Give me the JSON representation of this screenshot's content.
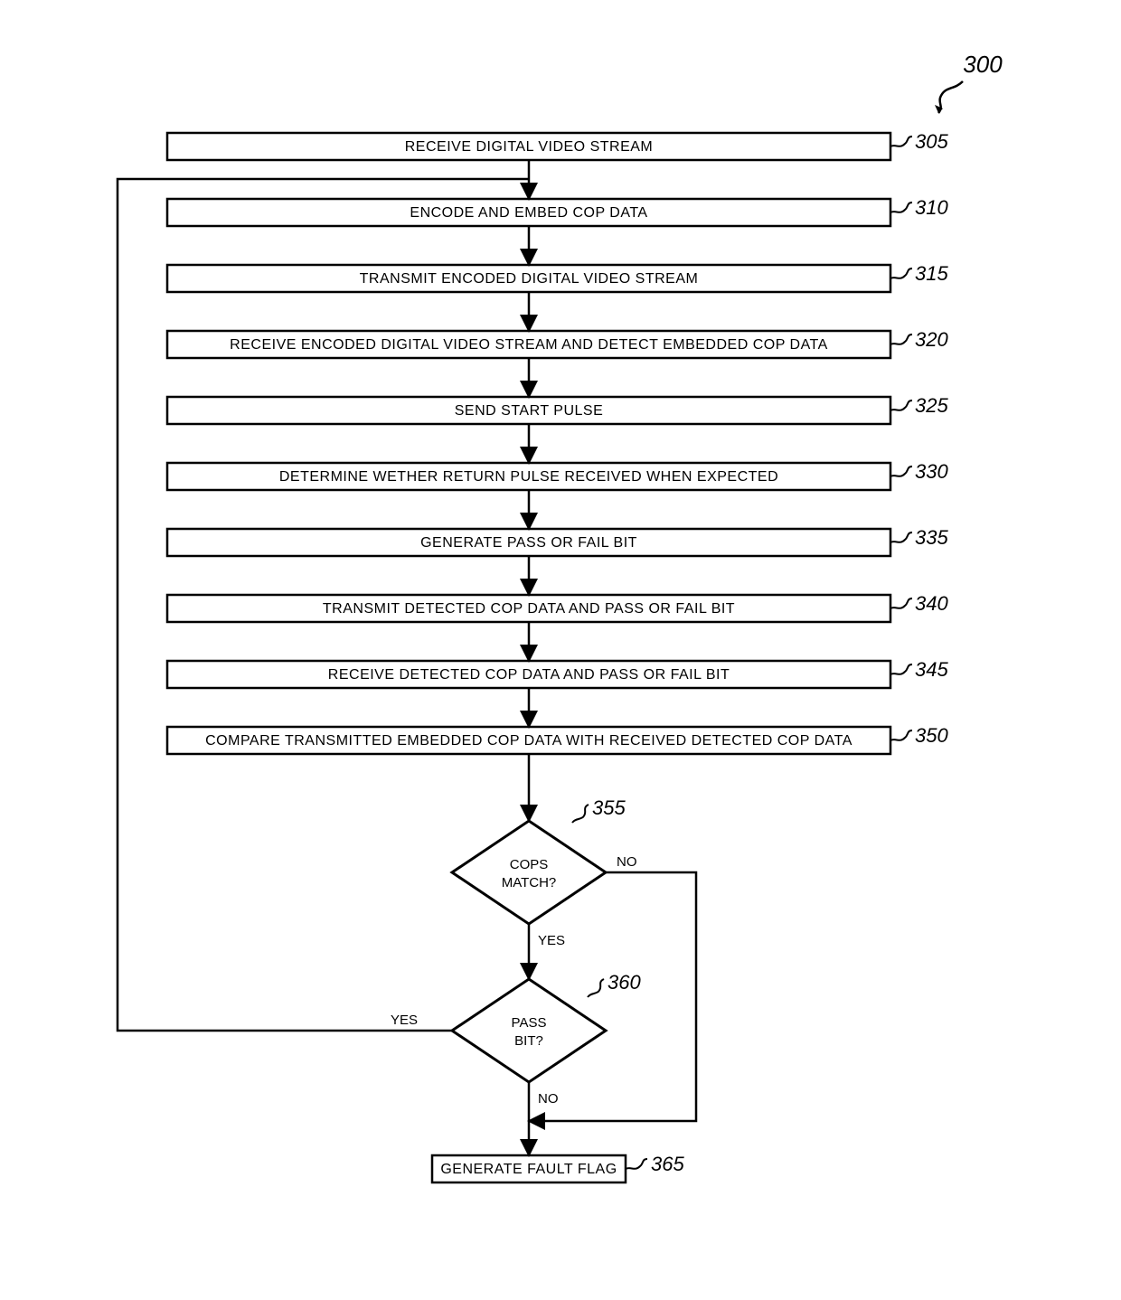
{
  "title_ref": "300",
  "steps": [
    {
      "ref": "305",
      "label": "RECEIVE DIGITAL VIDEO STREAM"
    },
    {
      "ref": "310",
      "label": "ENCODE AND EMBED COP DATA"
    },
    {
      "ref": "315",
      "label": "TRANSMIT ENCODED DIGITAL VIDEO STREAM"
    },
    {
      "ref": "320",
      "label": "RECEIVE ENCODED DIGITAL VIDEO STREAM AND DETECT EMBEDDED COP DATA"
    },
    {
      "ref": "325",
      "label": "SEND START PULSE"
    },
    {
      "ref": "330",
      "label": "DETERMINE WETHER RETURN PULSE RECEIVED WHEN EXPECTED"
    },
    {
      "ref": "335",
      "label": "GENERATE PASS OR FAIL BIT"
    },
    {
      "ref": "340",
      "label": "TRANSMIT DETECTED COP DATA AND PASS OR FAIL BIT"
    },
    {
      "ref": "345",
      "label": "RECEIVE DETECTED COP DATA AND PASS OR FAIL BIT"
    },
    {
      "ref": "350",
      "label": "COMPARE TRANSMITTED  EMBEDDED COP DATA  WITH RECEIVED DETECTED COP DATA"
    }
  ],
  "diamond1": {
    "ref": "355",
    "line1": "COPS",
    "line2": "MATCH?"
  },
  "diamond2": {
    "ref": "360",
    "line1": "PASS",
    "line2": "BIT?"
  },
  "final": {
    "ref": "365",
    "label": "GENERATE FAULT FLAG"
  },
  "labels": {
    "yes": "YES",
    "no": "NO"
  }
}
